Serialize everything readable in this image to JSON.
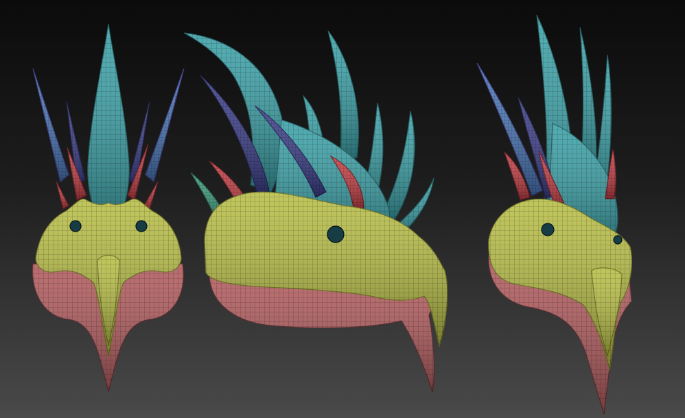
{
  "scene": {
    "background_top": "#0b0b0b",
    "background_bottom": "#4a4a4a",
    "views": [
      {
        "name": "front"
      },
      {
        "name": "side"
      },
      {
        "name": "three-quarter"
      }
    ]
  },
  "palette": {
    "skull": "#b7bd45",
    "skull_dark": "#6d7020",
    "jaw": "#b05a5c",
    "jaw_dark": "#5c2a2d",
    "crest": "#3aa0a6",
    "crest_dark": "#1e5d63",
    "spike_blue": "#4a78b8",
    "spike_indigo": "#3c3f8a",
    "spike_red": "#c33f45",
    "spike_green": "#3c9a7a",
    "eye": "#173c44",
    "wire": "#000000"
  }
}
